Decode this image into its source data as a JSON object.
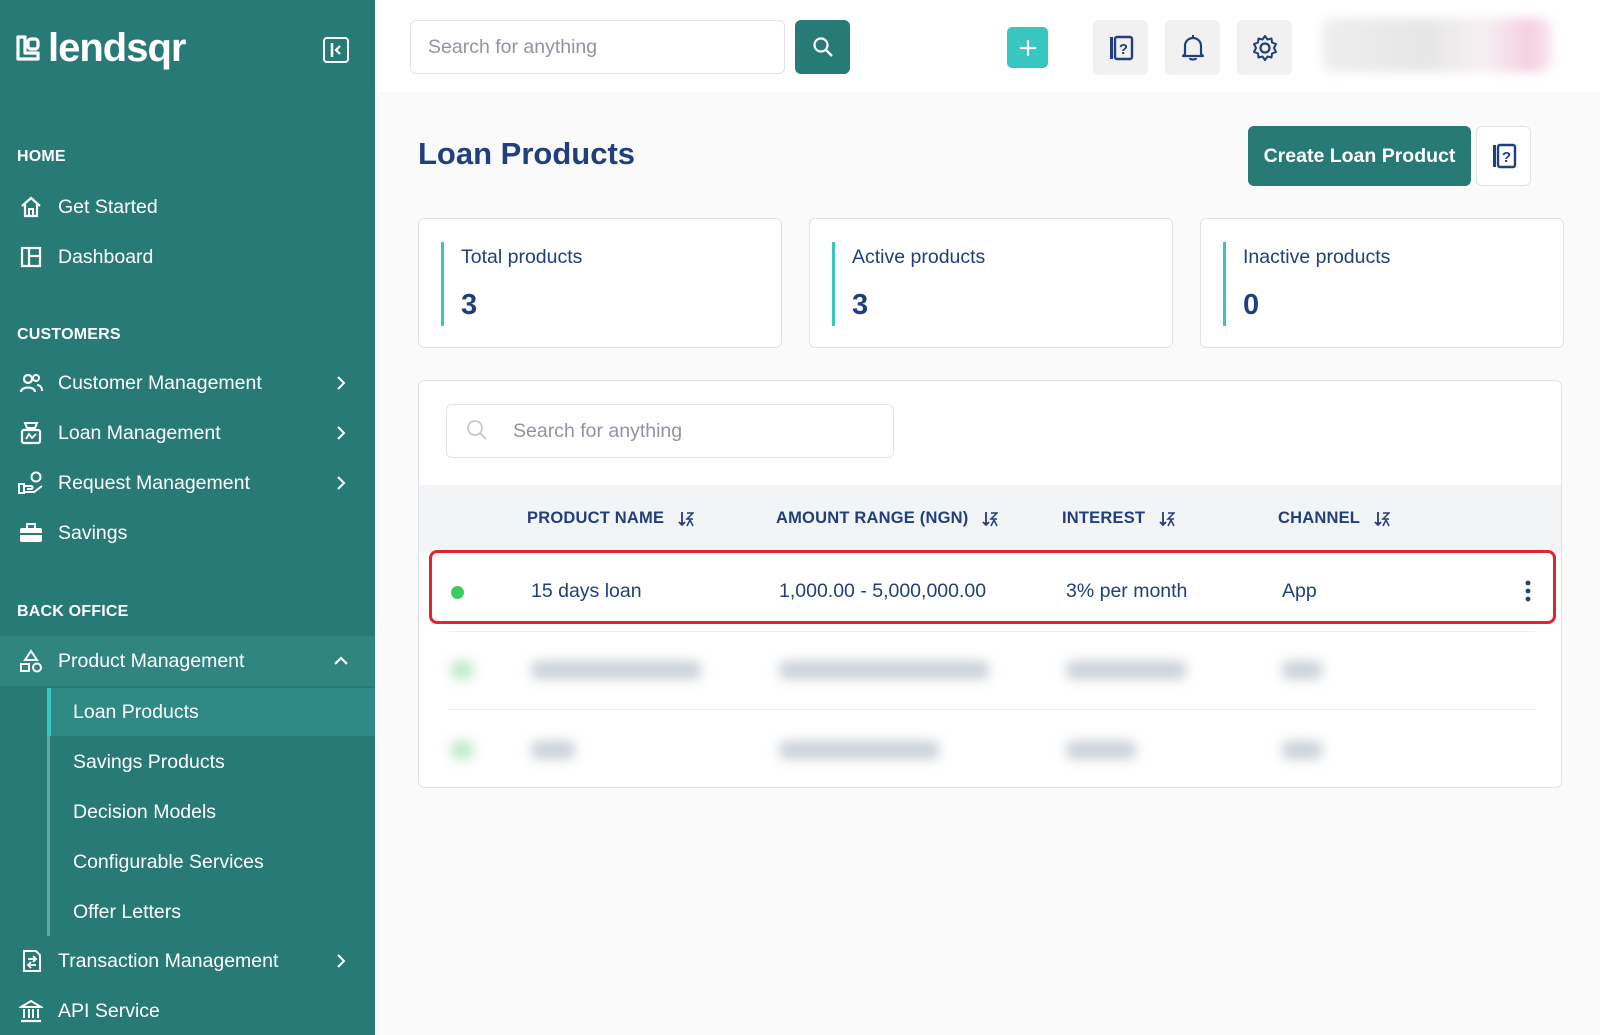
{
  "brand": {
    "name": "lendsqr"
  },
  "sidebar": {
    "sections": {
      "home": "HOME",
      "customers": "CUSTOMERS",
      "back_office": "BACK OFFICE"
    },
    "items": {
      "get_started": "Get Started",
      "dashboard": "Dashboard",
      "customer_management": "Customer Management",
      "loan_management": "Loan Management",
      "request_management": "Request Management",
      "savings": "Savings",
      "product_management": "Product Management",
      "transaction_management": "Transaction Management",
      "api_service": "API Service"
    },
    "product_submenu": {
      "loan_products": "Loan Products",
      "savings_products": "Savings Products",
      "decision_models": "Decision Models",
      "configurable_services": "Configurable Services",
      "offer_letters": "Offer Letters"
    }
  },
  "topbar": {
    "search_placeholder": "Search for anything"
  },
  "page": {
    "title": "Loan Products",
    "create_button": "Create Loan Product"
  },
  "stats": {
    "total": {
      "label": "Total products",
      "value": "3"
    },
    "active": {
      "label": "Active products",
      "value": "3"
    },
    "inactive": {
      "label": "Inactive products",
      "value": "0"
    }
  },
  "table": {
    "search_placeholder": "Search for anything",
    "columns": {
      "product_name": "PRODUCT NAME",
      "amount_range": "AMOUNT RANGE (NGN)",
      "interest": "INTEREST",
      "channel": "CHANNEL"
    },
    "rows": [
      {
        "product_name": "15 days loan",
        "amount_range": "1,000.00 - 5,000,000.00",
        "interest": "3% per month",
        "channel": "App",
        "status_color": "#39cd62"
      }
    ]
  },
  "colors": {
    "sidebar": "#287a76",
    "accent": "#39c6c0",
    "text": "#213f7d",
    "highlight": "#e0252f",
    "status_active": "#39cd62"
  }
}
